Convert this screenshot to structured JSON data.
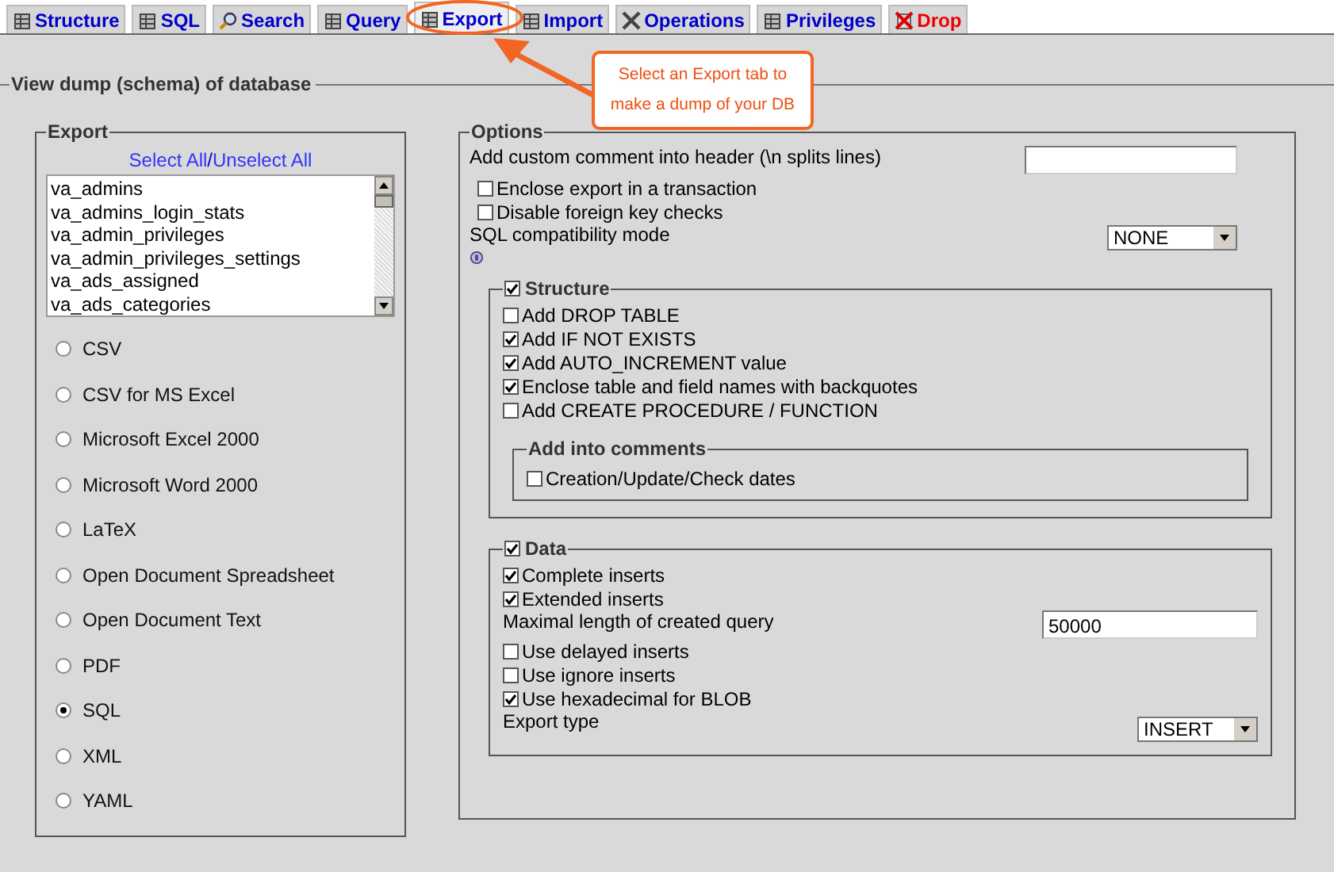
{
  "tabs": [
    {
      "label": "Structure",
      "selected": false,
      "kind": "normal"
    },
    {
      "label": "SQL",
      "selected": false,
      "kind": "normal"
    },
    {
      "label": "Search",
      "selected": false,
      "kind": "normal"
    },
    {
      "label": "Query",
      "selected": false,
      "kind": "normal"
    },
    {
      "label": "Export",
      "selected": true,
      "kind": "normal"
    },
    {
      "label": "Import",
      "selected": false,
      "kind": "normal"
    },
    {
      "label": "Operations",
      "selected": false,
      "kind": "normal"
    },
    {
      "label": "Privileges",
      "selected": false,
      "kind": "normal"
    },
    {
      "label": "Drop",
      "selected": false,
      "kind": "danger"
    }
  ],
  "callout": {
    "text": "Select an Export tab to make a dump of your DB"
  },
  "title": "View dump (schema) of database",
  "export": {
    "title": "Export",
    "select_all": "Select All",
    "separator": "/",
    "unselect_all": "Unselect All",
    "tables": [
      "va_admins",
      "va_admins_login_stats",
      "va_admin_privileges",
      "va_admin_privileges_settings",
      "va_ads_assigned",
      "va_ads_categories"
    ],
    "formats": [
      {
        "label": "CSV",
        "selected": false
      },
      {
        "label": "CSV for MS Excel",
        "selected": false
      },
      {
        "label": "Microsoft Excel 2000",
        "selected": false
      },
      {
        "label": "Microsoft Word 2000",
        "selected": false
      },
      {
        "label": "LaTeX",
        "selected": false
      },
      {
        "label": "Open Document Spreadsheet",
        "selected": false
      },
      {
        "label": "Open Document Text",
        "selected": false
      },
      {
        "label": "PDF",
        "selected": false
      },
      {
        "label": "SQL",
        "selected": true
      },
      {
        "label": "XML",
        "selected": false
      },
      {
        "label": "YAML",
        "selected": false
      }
    ]
  },
  "options": {
    "title": "Options",
    "items": [
      {
        "kind": "text",
        "label": "Add custom comment into header (\\n splits lines)"
      },
      {
        "kind": "check",
        "label": "Enclose export in a transaction",
        "checked": false
      },
      {
        "kind": "check",
        "label": "Disable foreign key checks",
        "checked": false
      },
      {
        "kind": "select",
        "label": "SQL compatibility mode",
        "value": "NONE"
      }
    ],
    "structure": {
      "label": "Structure",
      "checked": true,
      "items": [
        {
          "kind": "check",
          "label": "Add DROP TABLE",
          "checked": false
        },
        {
          "kind": "check",
          "label": "Add IF NOT EXISTS",
          "checked": true
        },
        {
          "kind": "check",
          "label": "Add AUTO_INCREMENT value",
          "checked": true
        },
        {
          "kind": "check",
          "label": "Enclose table and field names with backquotes",
          "checked": true
        },
        {
          "kind": "check",
          "label": "Add CREATE PROCEDURE / FUNCTION",
          "checked": false
        }
      ],
      "comments": {
        "title": "Add into comments",
        "items": [
          {
            "kind": "check",
            "label": "Creation/Update/Check dates",
            "checked": false
          }
        ]
      }
    },
    "data": {
      "label": "Data",
      "checked": true,
      "items": [
        {
          "kind": "check",
          "label": "Complete inserts",
          "checked": true
        },
        {
          "kind": "check",
          "label": "Extended inserts",
          "checked": true
        },
        {
          "kind": "text",
          "label": "Maximal length of created query",
          "value": "50000"
        },
        {
          "kind": "check",
          "label": "Use delayed inserts",
          "checked": false
        },
        {
          "kind": "check",
          "label": "Use ignore inserts",
          "checked": false
        },
        {
          "kind": "check",
          "label": "Use hexadecimal for BLOB",
          "checked": true
        },
        {
          "kind": "select",
          "label": "Export type",
          "value": "INSERT"
        }
      ]
    }
  }
}
